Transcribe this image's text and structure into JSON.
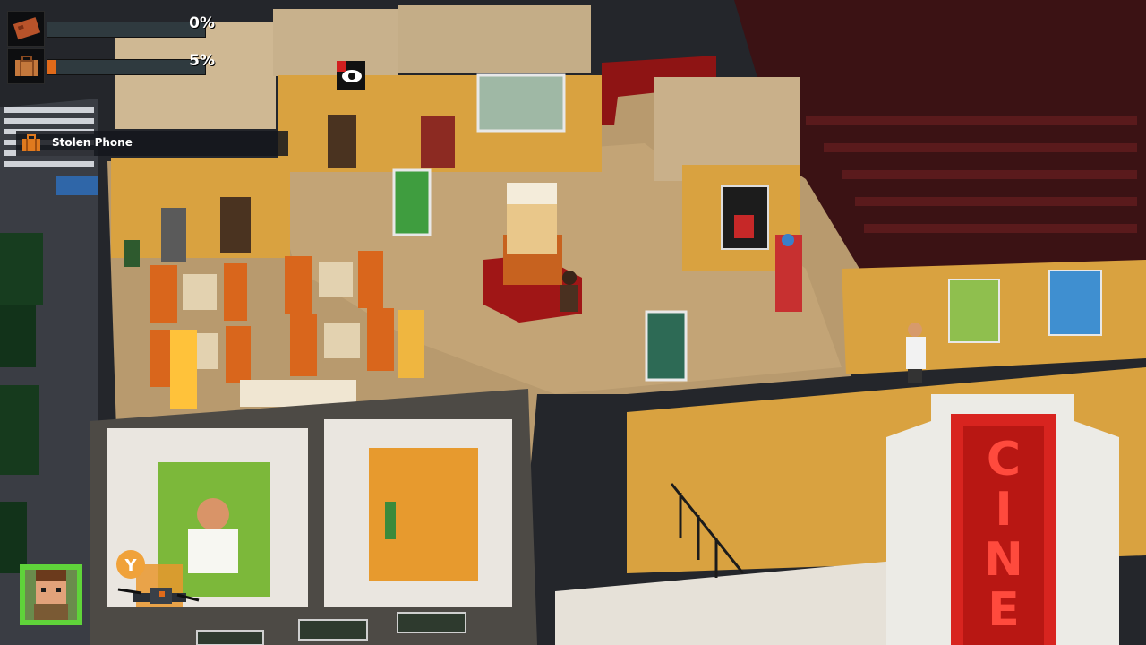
{
  "hud": {
    "bars": [
      {
        "icon": "brick-icon",
        "value_text": "0%",
        "progress": 0
      },
      {
        "icon": "suitcase-icon",
        "value_text": "5%",
        "progress": 5
      }
    ],
    "objective": {
      "icon": "briefcase-icon",
      "label": "Stolen Phone"
    },
    "ability_button": {
      "key": "Y",
      "icon": "drone-icon"
    },
    "marker": {
      "icon": "eye-icon"
    }
  },
  "signs": {
    "cinema_letters": "CINEM"
  },
  "colors": {
    "accent": "#e06a1a",
    "hud_track": "#2f3a3f",
    "avatar_frame": "#5fd33a",
    "sign_red": "#d8241f",
    "wall_yellow": "#d9a240",
    "floor": "#b89a6e"
  }
}
